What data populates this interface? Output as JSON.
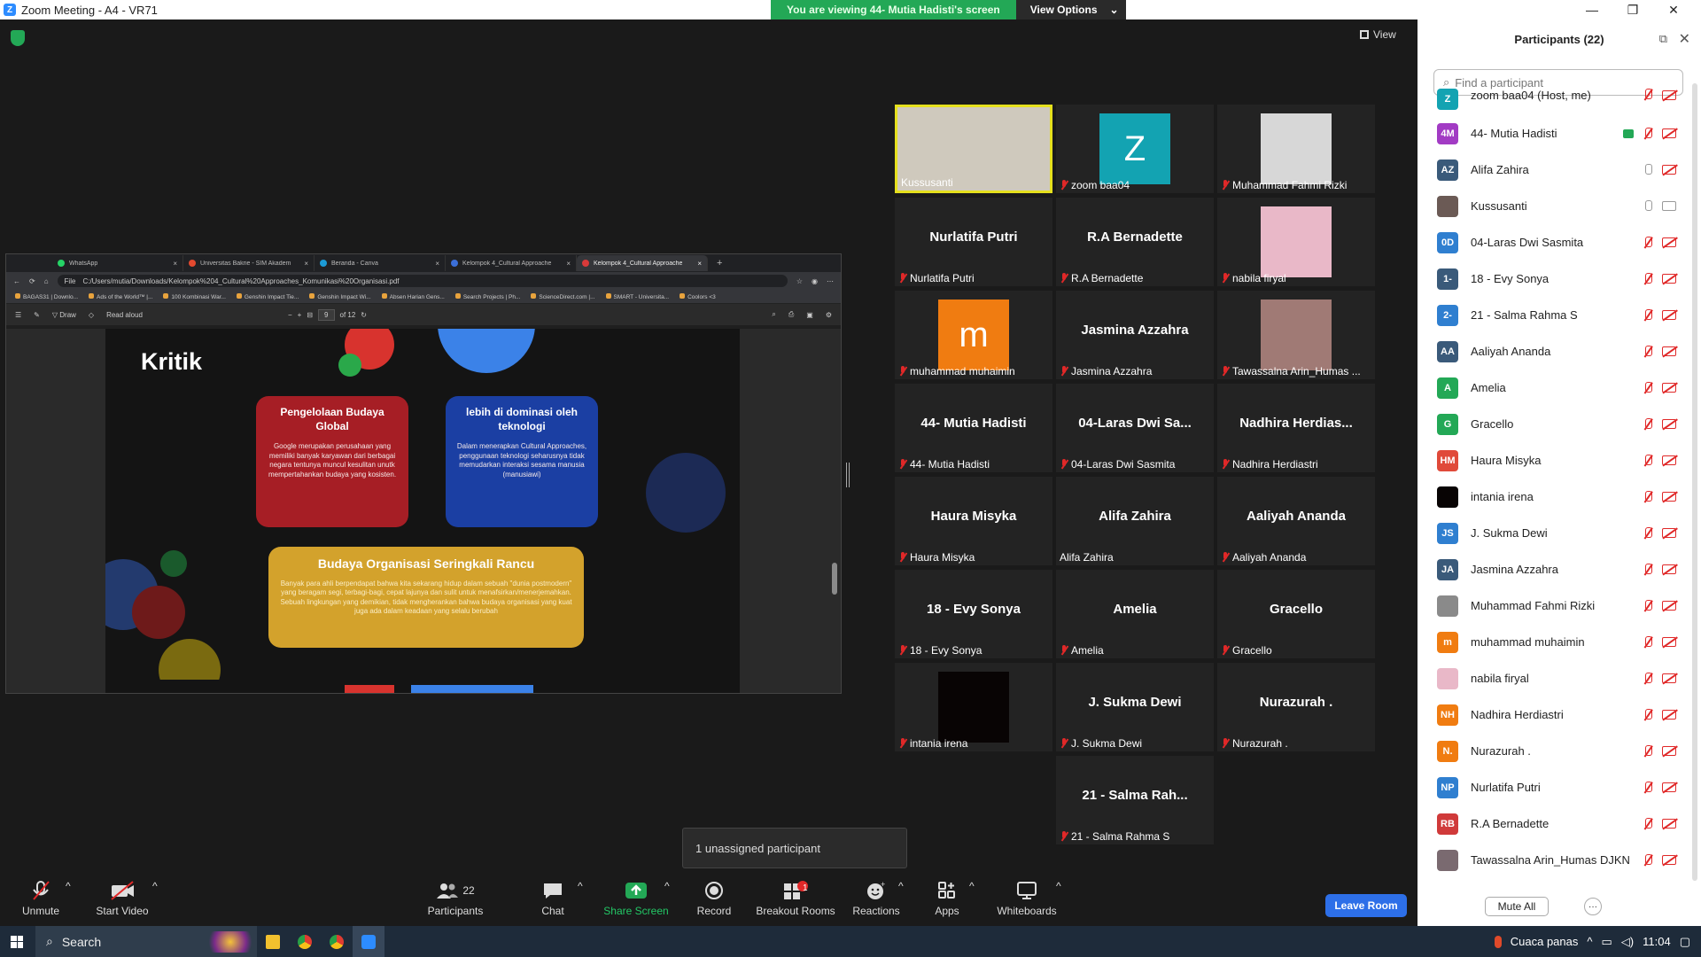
{
  "window": {
    "title": "Zoom Meeting - A4 - VR71",
    "minimize": "—",
    "maximize": "❐",
    "close": "✕"
  },
  "banner": {
    "message": "You are viewing 44- Mutia Hadisti's screen",
    "view_options": "View Options"
  },
  "view_button": "View",
  "browser": {
    "tabs": [
      {
        "label": "WhatsApp",
        "color": "#25d366"
      },
      {
        "label": "Universitas Bakrie - SIM Akadem",
        "color": "#e3492f"
      },
      {
        "label": "Beranda - Canva",
        "color": "#1c9bd6"
      },
      {
        "label": "Kelompok 4_Cultural Approache",
        "color": "#3b6fd8"
      },
      {
        "label": "Kelompok 4_Cultural Approache",
        "color": "#d93a3a"
      }
    ],
    "file_label": "File",
    "url": "C:/Users/mutia/Downloads/Kelompok%204_Cultural%20Approaches_Komunikasi%20Organisasi.pdf",
    "bookmarks": [
      "BAGAS31 | Downlo...",
      "Ads of the World™ |...",
      "100 Kombinasi War...",
      "Genshin Impact Tie...",
      "Genshin Impact Wi...",
      "Absen Harian Gens...",
      "Search Projects | Ph...",
      "ScienceDirect.com |...",
      "SMART - Universita...",
      "Coolors <3"
    ],
    "pdf_toolbar": {
      "draw": "Draw",
      "read_aloud": "Read aloud",
      "page": "9",
      "of": "of 12"
    }
  },
  "slide": {
    "title": "Kritik",
    "card1": {
      "title": "Pengelolaan Budaya Global",
      "body": "Google merupakan perusahaan yang memiliki banyak karyawan dari berbagai negara tentunya muncul kesulitan unutk mempertahankan budaya yang kosisten."
    },
    "card2": {
      "title": "lebih di dominasi oleh teknologi",
      "body": "Dalam menerapkan Cultural Approaches, penggunaan teknologi seharusnya tidak memudarkan interaksi sesama manusia (manusiawi)"
    },
    "card3": {
      "title": "Budaya Organisasi Seringkali Rancu",
      "body": "Banyak para ahli berpendapat bahwa kita sekarang hidup dalam sebuah \"dunia postmodern\" yang beragam segi, terbagi-bagi, cepat lajunya dan sulit untuk menafsirkan/menerjemahkan. Sebuah lingkungan yang demikian, tidak mengherankan bahwa budaya organisasi yang kuat juga ada dalam keadaan yang selalu berubah"
    }
  },
  "tiles": [
    {
      "name": "Kussusanti",
      "type": "photo",
      "color": "#cfc9bd",
      "muted": false,
      "speaking": true
    },
    {
      "name": "zoom baa04",
      "type": "avatar",
      "letter": "Z",
      "color": "#13a3b2",
      "muted": true
    },
    {
      "name": "Muhammad Fahmi Rizki",
      "type": "photo",
      "color": "#d7d7d7",
      "muted": true
    },
    {
      "name": "Nurlatifa Putri",
      "type": "text",
      "big": "Nurlatifa Putri",
      "muted": true
    },
    {
      "name": "R.A Bernadette",
      "type": "text",
      "big": "R.A Bernadette",
      "muted": true
    },
    {
      "name": "nabila firyal",
      "type": "photo",
      "color": "#e9b8c8",
      "muted": true
    },
    {
      "name": "muhammad muhaimin",
      "type": "avatar",
      "letter": "m",
      "color": "#f07c11",
      "muted": true
    },
    {
      "name": "Jasmina Azzahra",
      "type": "text",
      "big": "Jasmina Azzahra",
      "muted": true
    },
    {
      "name": "Tawassalna Arin_Humas ...",
      "type": "photo",
      "color": "#a07a75",
      "muted": true
    },
    {
      "name": "44- Mutia Hadisti",
      "type": "text",
      "big": "44- Mutia Hadisti",
      "muted": true
    },
    {
      "name": "04-Laras Dwi Sasmita",
      "type": "text",
      "big": "04-Laras Dwi Sa...",
      "muted": true
    },
    {
      "name": "Nadhira Herdiastri",
      "type": "text",
      "big": "Nadhira Herdias...",
      "muted": true
    },
    {
      "name": "Haura Misyka",
      "type": "text",
      "big": "Haura Misyka",
      "muted": true
    },
    {
      "name": "Alifa Zahira",
      "type": "text",
      "big": "Alifa Zahira",
      "muted": false
    },
    {
      "name": "Aaliyah Ananda",
      "type": "text",
      "big": "Aaliyah Ananda",
      "muted": true
    },
    {
      "name": "18 - Evy Sonya",
      "type": "text",
      "big": "18 - Evy Sonya",
      "muted": true
    },
    {
      "name": "Amelia",
      "type": "text",
      "big": "Amelia",
      "muted": true
    },
    {
      "name": "Gracello",
      "type": "text",
      "big": "Gracello",
      "muted": true
    },
    {
      "name": "intania irena",
      "type": "photo",
      "color": "#080404",
      "muted": true
    },
    {
      "name": "J. Sukma Dewi",
      "type": "text",
      "big": "J. Sukma Dewi",
      "muted": true
    },
    {
      "name": "Nurazurah .",
      "type": "text",
      "big": "Nurazurah .",
      "muted": true
    },
    {
      "name": "21 - Salma Rahma S",
      "type": "text",
      "big": "21 - Salma Rah...",
      "muted": true
    }
  ],
  "toast": "1 unassigned participant",
  "controls": {
    "unmute": "Unmute",
    "start_video": "Start Video",
    "participants": "Participants",
    "participants_count": "22",
    "chat": "Chat",
    "share_screen": "Share Screen",
    "record": "Record",
    "breakout": "Breakout Rooms",
    "breakout_badge": "1",
    "reactions": "Reactions",
    "apps": "Apps",
    "whiteboards": "Whiteboards",
    "leave": "Leave Room"
  },
  "panel": {
    "title": "Participants (22)",
    "search_placeholder": "Find a participant",
    "mute_all": "Mute All",
    "more": "···",
    "participants": [
      {
        "initials": "Z",
        "name": "zoom baa04 (Host, me)",
        "color": "#13a3b2",
        "mic": "muted",
        "cam": "off"
      },
      {
        "initials": "4M",
        "name": "44- Mutia Hadisti",
        "color": "#a23bc4",
        "mic": "muted",
        "cam": "off",
        "sharing": true
      },
      {
        "initials": "AZ",
        "name": "Alifa Zahira",
        "color": "#3a5a7a",
        "mic": "on",
        "cam": "off"
      },
      {
        "initials": "",
        "name": "Kussusanti",
        "color": "#6b5a55",
        "mic": "on",
        "cam": "on"
      },
      {
        "initials": "0D",
        "name": "04-Laras Dwi Sasmita",
        "color": "#2f7fd0",
        "mic": "muted",
        "cam": "off"
      },
      {
        "initials": "1-",
        "name": "18 - Evy Sonya",
        "color": "#3a5a7a",
        "mic": "muted",
        "cam": "off"
      },
      {
        "initials": "2-",
        "name": "21 - Salma Rahma S",
        "color": "#2f7fd0",
        "mic": "muted",
        "cam": "off"
      },
      {
        "initials": "AA",
        "name": "Aaliyah Ananda",
        "color": "#3a5a7a",
        "mic": "muted",
        "cam": "off"
      },
      {
        "initials": "A",
        "name": "Amelia",
        "color": "#23a856",
        "mic": "muted",
        "cam": "off"
      },
      {
        "initials": "G",
        "name": "Gracello",
        "color": "#23a856",
        "mic": "muted",
        "cam": "off"
      },
      {
        "initials": "HM",
        "name": "Haura Misyka",
        "color": "#e04a3a",
        "mic": "muted",
        "cam": "off"
      },
      {
        "initials": "",
        "name": "intania irena",
        "color": "#080404",
        "mic": "muted",
        "cam": "off"
      },
      {
        "initials": "JS",
        "name": "J. Sukma Dewi",
        "color": "#2f7fd0",
        "mic": "muted",
        "cam": "off"
      },
      {
        "initials": "JA",
        "name": "Jasmina Azzahra",
        "color": "#3a5a7a",
        "mic": "muted",
        "cam": "off"
      },
      {
        "initials": "",
        "name": "Muhammad Fahmi Rizki",
        "color": "#8a8a8a",
        "mic": "muted",
        "cam": "off"
      },
      {
        "initials": "m",
        "name": "muhammad muhaimin",
        "color": "#f07c11",
        "mic": "muted",
        "cam": "off"
      },
      {
        "initials": "",
        "name": "nabila firyal",
        "color": "#e9b8c8",
        "mic": "muted",
        "cam": "off"
      },
      {
        "initials": "NH",
        "name": "Nadhira Herdiastri",
        "color": "#f07c11",
        "mic": "muted",
        "cam": "off"
      },
      {
        "initials": "N.",
        "name": "Nurazurah .",
        "color": "#f07c11",
        "mic": "muted",
        "cam": "off"
      },
      {
        "initials": "NP",
        "name": "Nurlatifa Putri",
        "color": "#2f7fd0",
        "mic": "muted",
        "cam": "off"
      },
      {
        "initials": "RB",
        "name": "R.A Bernadette",
        "color": "#d03a3a",
        "mic": "muted",
        "cam": "off"
      },
      {
        "initials": "",
        "name": "Tawassalna Arin_Humas DJKN",
        "color": "#7a6a70",
        "mic": "muted",
        "cam": "off"
      }
    ]
  },
  "taskbar": {
    "search": "Search",
    "weather": "Cuaca panas",
    "time": "11:04"
  }
}
